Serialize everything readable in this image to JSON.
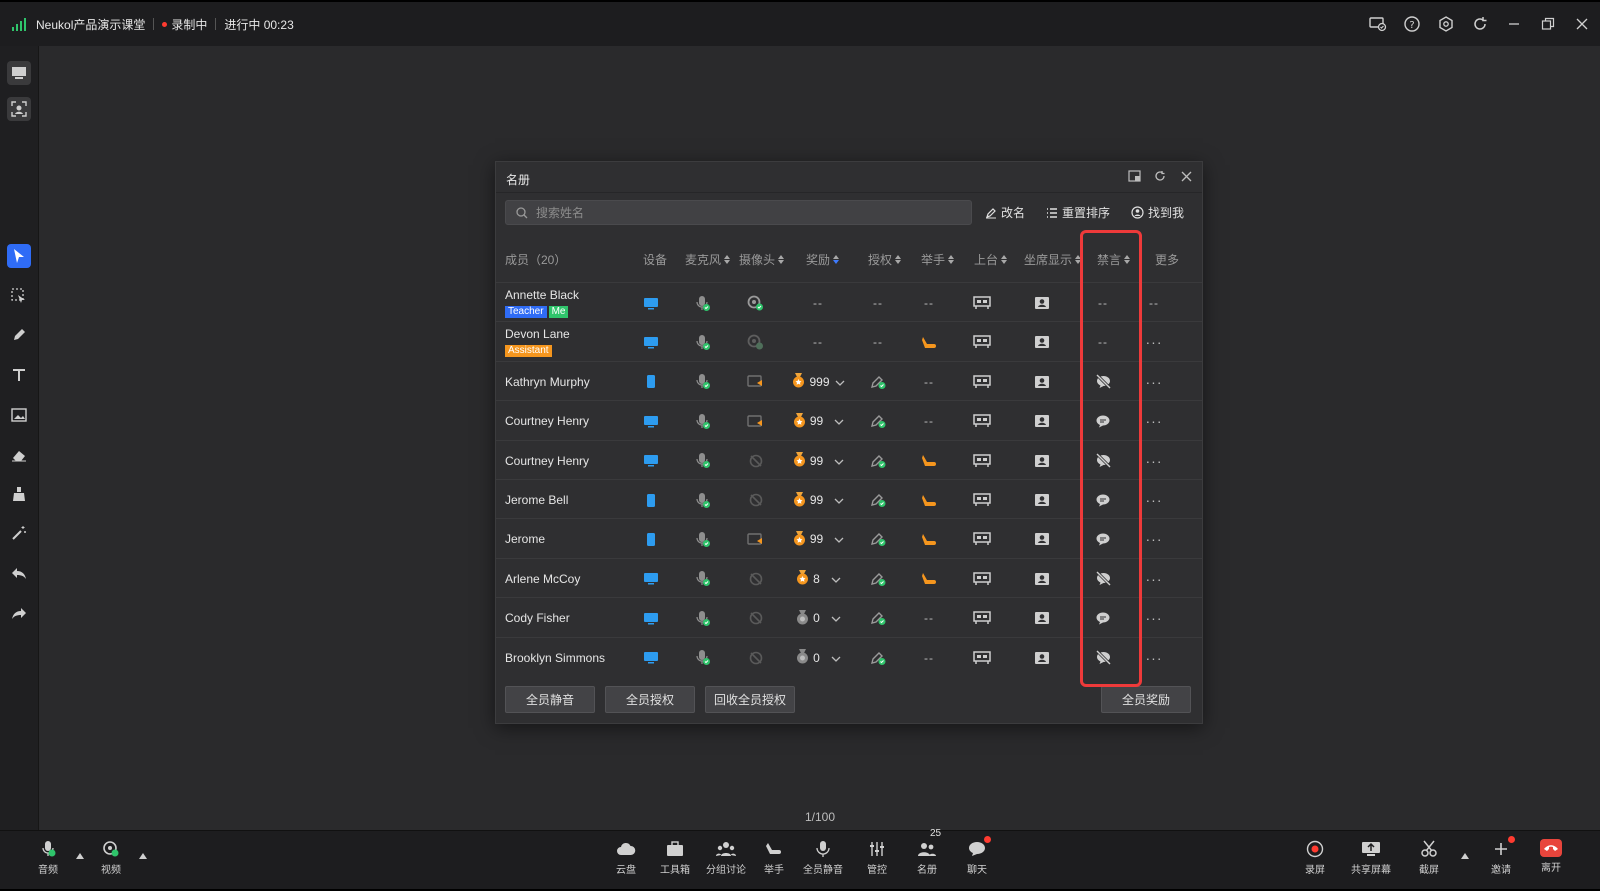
{
  "titlebar": {
    "app_name": "Neukol产品演示课堂",
    "recording": "录制中",
    "status": "进行中 00:23"
  },
  "roster": {
    "title": "名册",
    "search_placeholder": "搜索姓名",
    "actions": {
      "rename": "改名",
      "reorder": "重置排序",
      "find_me": "找到我"
    },
    "columns": {
      "member": "成员（20）",
      "device": "设备",
      "mic": "麦克风",
      "camera": "摄像头",
      "reward": "奖励",
      "auth": "授权",
      "raise_hand": "举手",
      "stage": "上台",
      "seat": "坐席显示",
      "mute_chat": "禁言",
      "more": "更多"
    },
    "rows": [
      {
        "name": "Annette Black",
        "badges": [
          "Teacher",
          "Me"
        ],
        "device": "desktop",
        "camera": "on",
        "reward": "--",
        "auth": "--",
        "hand": "--",
        "mute": "--",
        "more": "--"
      },
      {
        "name": "Devon Lane",
        "badges": [
          "Assistant"
        ],
        "device": "desktop",
        "camera": "dim",
        "reward": "--",
        "auth": "--",
        "hand": "raised",
        "mute": "--",
        "more": "..."
      },
      {
        "name": "Kathryn Murphy",
        "badges": [],
        "device": "mobile",
        "camera": "screen",
        "reward": "999",
        "auth": "on",
        "hand": "--",
        "mute": "muted",
        "more": "..."
      },
      {
        "name": "Courtney Henry",
        "badges": [],
        "device": "desktop",
        "camera": "screen",
        "reward": "99",
        "auth": "on",
        "hand": "--",
        "mute": "chat",
        "more": "..."
      },
      {
        "name": "Courtney Henry",
        "badges": [],
        "device": "desktop",
        "camera": "off",
        "reward": "99",
        "auth": "on",
        "hand": "raised",
        "mute": "muted",
        "more": "..."
      },
      {
        "name": "Jerome Bell",
        "badges": [],
        "device": "mobile",
        "camera": "off",
        "reward": "99",
        "auth": "on",
        "hand": "raised",
        "mute": "chat",
        "more": "..."
      },
      {
        "name": "Jerome",
        "badges": [],
        "device": "mobile",
        "camera": "screen",
        "reward": "99",
        "auth": "on",
        "hand": "raised",
        "mute": "chat",
        "more": "..."
      },
      {
        "name": "Arlene McCoy",
        "badges": [],
        "device": "desktop",
        "camera": "off",
        "reward": "8",
        "auth": "on",
        "hand": "raised",
        "mute": "muted",
        "more": "..."
      },
      {
        "name": "Cody Fisher",
        "badges": [],
        "device": "desktop",
        "camera": "off",
        "reward": "0",
        "auth": "on",
        "hand": "--",
        "mute": "chat",
        "more": "..."
      },
      {
        "name": "Brooklyn Simmons",
        "badges": [],
        "device": "desktop",
        "camera": "off",
        "reward": "0",
        "auth": "on",
        "hand": "--",
        "mute": "muted",
        "more": "..."
      }
    ],
    "footer": {
      "mute_all": "全员静音",
      "auth_all": "全员授权",
      "revoke_all": "回收全员授权",
      "reward_all": "全员奖励"
    }
  },
  "pager": "1/100",
  "bottombar": {
    "left": [
      {
        "label": "音频",
        "icon": "mic-icon"
      },
      {
        "label": "视频",
        "icon": "camera-icon"
      }
    ],
    "center": [
      {
        "label": "云盘",
        "icon": "cloud-icon"
      },
      {
        "label": "工具箱",
        "icon": "toolbox-icon"
      },
      {
        "label": "分组讨论",
        "icon": "group-icon"
      },
      {
        "label": "举手",
        "icon": "hand-icon"
      },
      {
        "label": "全员静音",
        "icon": "mute-all-icon"
      },
      {
        "label": "管控",
        "icon": "control-icon"
      },
      {
        "label": "名册",
        "icon": "roster-icon",
        "count": "25"
      },
      {
        "label": "聊天",
        "icon": "chat-icon"
      }
    ],
    "right": [
      {
        "label": "录屏",
        "icon": "record-icon"
      },
      {
        "label": "共享屏幕",
        "icon": "share-screen-icon"
      },
      {
        "label": "截屏",
        "icon": "screenshot-icon"
      },
      {
        "label": "邀请",
        "icon": "invite-icon"
      },
      {
        "label": "离开",
        "icon": "leave-icon"
      }
    ]
  },
  "colors": {
    "accent": "#2f6cf6",
    "green": "#2fc46b",
    "orange": "#f5961e",
    "highlight": "#ee3a3a",
    "device": "#2d9cf0"
  }
}
